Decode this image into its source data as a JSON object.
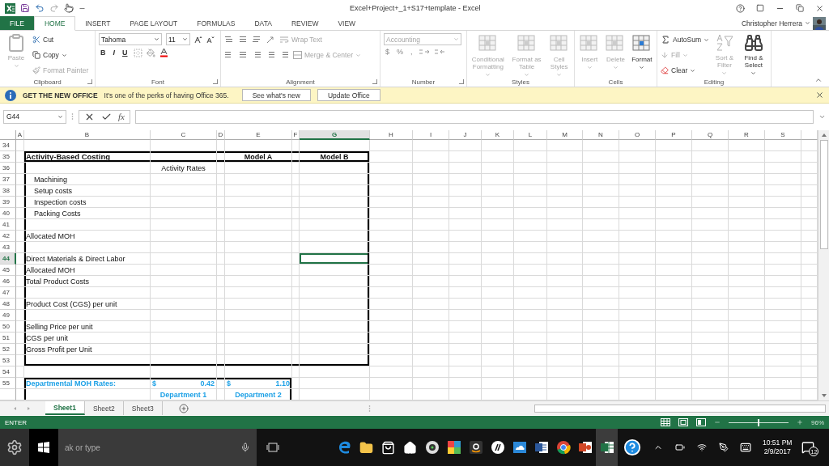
{
  "title_bar": {
    "title": "Excel+Project+_1+S17+template - Excel"
  },
  "ribbon_tabs": [
    {
      "label": "FILE",
      "kind": "file",
      "selected": false
    },
    {
      "label": "HOME",
      "kind": "tab",
      "selected": true
    },
    {
      "label": "INSERT",
      "kind": "tab",
      "selected": false
    },
    {
      "label": "PAGE LAYOUT",
      "kind": "tab",
      "selected": false
    },
    {
      "label": "FORMULAS",
      "kind": "tab",
      "selected": false
    },
    {
      "label": "DATA",
      "kind": "tab",
      "selected": false
    },
    {
      "label": "REVIEW",
      "kind": "tab",
      "selected": false
    },
    {
      "label": "VIEW",
      "kind": "tab",
      "selected": false
    }
  ],
  "account": {
    "user": "Christopher Herrera"
  },
  "ribbon": {
    "clipboard": {
      "label": "Clipboard",
      "paste": {
        "label": "Paste",
        "disabled": true
      },
      "cut": {
        "label": "Cut",
        "disabled": false
      },
      "copy": {
        "label": "Copy",
        "disabled": false
      },
      "format_painter": {
        "label": "Format Painter",
        "disabled": true
      }
    },
    "font": {
      "label": "Font",
      "font_name": "Tahoma",
      "font_size": "11",
      "bold": "B",
      "italic": "I",
      "underline": "U"
    },
    "alignment": {
      "label": "Alignment",
      "wrap_text": {
        "label": "Wrap Text",
        "disabled": true
      },
      "merge": {
        "label": "Merge & Center",
        "disabled": true
      }
    },
    "number": {
      "label": "Number",
      "format": {
        "value": "Accounting",
        "disabled": true
      },
      "currency": "$",
      "percent": "%",
      "comma": ","
    },
    "styles": {
      "label": "Styles",
      "buttons": [
        {
          "label": "Conditional Formatting",
          "disabled": true
        },
        {
          "label": "Format as Table",
          "disabled": true
        },
        {
          "label": "Cell Styles",
          "disabled": true
        }
      ]
    },
    "cells": {
      "label": "Cells",
      "buttons": [
        {
          "label": "Insert",
          "disabled": true
        },
        {
          "label": "Delete",
          "disabled": true
        },
        {
          "label": "Format",
          "disabled": false
        }
      ]
    },
    "editing": {
      "label": "Editing",
      "autosum": {
        "label": "AutoSum",
        "disabled": false
      },
      "fill": {
        "label": "Fill",
        "disabled": true
      },
      "clear": {
        "label": "Clear",
        "disabled": false
      },
      "sort": {
        "label": "Sort & Filter",
        "disabled": true
      },
      "find": {
        "label": "Find & Select",
        "disabled": false
      }
    }
  },
  "info_bar": {
    "title": "GET THE NEW OFFICE",
    "message": "It's one of the perks of having Office 365.",
    "buttons": [
      "See what's new",
      "Update Office"
    ]
  },
  "formula_bar": {
    "name_box": "G44",
    "function_label": "fx"
  },
  "sheet": {
    "columns": [
      {
        "label": "A",
        "selected": false
      },
      {
        "label": "B",
        "selected": false
      },
      {
        "label": "C",
        "selected": false
      },
      {
        "label": "D",
        "selected": false
      },
      {
        "label": "E",
        "selected": false
      },
      {
        "label": "F",
        "selected": false
      },
      {
        "label": "G",
        "selected": true
      },
      {
        "label": "H",
        "selected": false
      },
      {
        "label": "I",
        "selected": false
      },
      {
        "label": "J",
        "selected": false
      },
      {
        "label": "K",
        "selected": false
      },
      {
        "label": "L",
        "selected": false
      },
      {
        "label": "M",
        "selected": false
      },
      {
        "label": "N",
        "selected": false
      },
      {
        "label": "O",
        "selected": false
      },
      {
        "label": "P",
        "selected": false
      },
      {
        "label": "Q",
        "selected": false
      },
      {
        "label": "R",
        "selected": false
      },
      {
        "label": "S",
        "selected": false
      }
    ],
    "rows": [
      {
        "number": "34",
        "selected": false
      },
      {
        "number": "35",
        "selected": false,
        "cells": [
          null,
          {
            "text": "Activity-Based Costing",
            "kind": "title"
          },
          null,
          null,
          {
            "text": "Model A",
            "kind": "heading"
          },
          null,
          {
            "text": "Model B",
            "kind": "heading"
          }
        ]
      },
      {
        "number": "36",
        "selected": false,
        "cells": [
          null,
          null,
          {
            "text": "Activity Rates",
            "kind": "centered"
          }
        ]
      },
      {
        "number": "37",
        "selected": false,
        "cells": [
          null,
          {
            "text": "Machining",
            "kind": "indented"
          }
        ]
      },
      {
        "number": "38",
        "selected": false,
        "cells": [
          null,
          {
            "text": "Setup costs",
            "kind": "indented"
          }
        ]
      },
      {
        "number": "39",
        "selected": false,
        "cells": [
          null,
          {
            "text": "Inspection costs",
            "kind": "indented"
          }
        ]
      },
      {
        "number": "40",
        "selected": false,
        "cells": [
          null,
          {
            "text": "Packing Costs",
            "kind": "indented"
          }
        ]
      },
      {
        "number": "41",
        "selected": false
      },
      {
        "number": "42",
        "selected": false,
        "cells": [
          null,
          {
            "text": "Allocated MOH",
            "kind": "plain"
          }
        ]
      },
      {
        "number": "43",
        "selected": false
      },
      {
        "number": "44",
        "selected": true,
        "cells": [
          null,
          {
            "text": "Direct Materials & Direct Labor",
            "kind": "plain"
          }
        ]
      },
      {
        "number": "45",
        "selected": false,
        "cells": [
          null,
          {
            "text": "Allocated MOH",
            "kind": "plain"
          }
        ]
      },
      {
        "number": "46",
        "selected": false,
        "cells": [
          null,
          {
            "text": "Total Product Costs",
            "kind": "plain"
          }
        ]
      },
      {
        "number": "47",
        "selected": false
      },
      {
        "number": "48",
        "selected": false,
        "cells": [
          null,
          {
            "text": "Product Cost (CGS) per unit",
            "kind": "plain"
          }
        ]
      },
      {
        "number": "49",
        "selected": false
      },
      {
        "number": "50",
        "selected": false,
        "cells": [
          null,
          {
            "text": "Selling Price per unit",
            "kind": "plain"
          }
        ]
      },
      {
        "number": "51",
        "selected": false,
        "cells": [
          null,
          {
            "text": "CGS per unit",
            "kind": "plain"
          }
        ]
      },
      {
        "number": "52",
        "selected": false,
        "cells": [
          null,
          {
            "text": "Gross Profit per Unit",
            "kind": "plain"
          }
        ]
      },
      {
        "number": "53",
        "selected": false
      },
      {
        "number": "54",
        "selected": false
      },
      {
        "number": "55",
        "selected": false,
        "cells": [
          null,
          {
            "text": "Departmental MOH Rates:",
            "kind": "accent"
          },
          {
            "symbol": "$",
            "text": "0.42",
            "kind": "accounting"
          },
          null,
          {
            "symbol": "$",
            "text": "1.10",
            "kind": "accounting"
          }
        ]
      },
      {
        "selected": false,
        "cells": [
          null,
          null,
          {
            "text": "Department 1",
            "kind": "accent-centered"
          },
          null,
          {
            "text": "Department 2",
            "kind": "accent-centered"
          }
        ]
      }
    ]
  },
  "sheet_tabs": [
    {
      "label": "Sheet1",
      "selected": true
    },
    {
      "label": "Sheet2",
      "selected": false
    },
    {
      "label": "Sheet3",
      "selected": false
    }
  ],
  "status_bar": {
    "mode": "ENTER",
    "zoom": "96%",
    "zoom_slider": {
      "level": 0.5
    }
  },
  "taskbar": {
    "search_placeholder": "ak or type",
    "time": "10:51 PM",
    "date": "2/9/2017",
    "notifications": "12"
  }
}
